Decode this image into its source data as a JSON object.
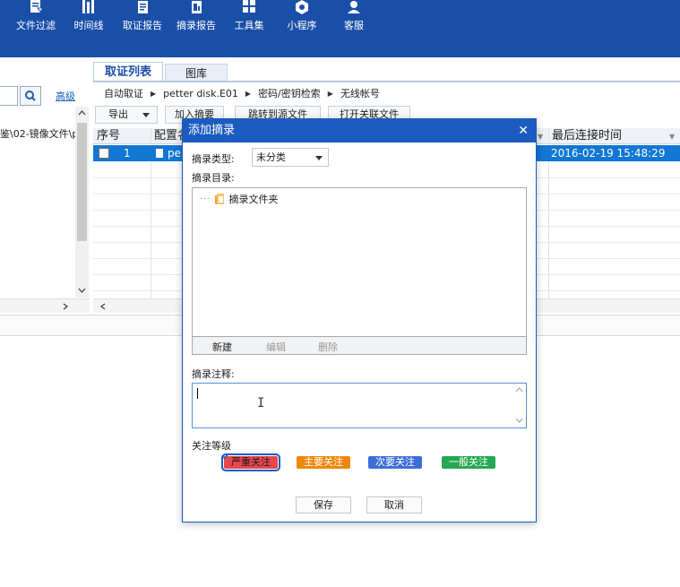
{
  "toolbar": {
    "items": [
      {
        "label": "文件过滤",
        "icon": "file-filter-icon"
      },
      {
        "label": "时间线",
        "icon": "timeline-icon"
      },
      {
        "label": "取证报告",
        "icon": "forensic-report-icon"
      },
      {
        "label": "摘录报告",
        "icon": "excerpt-report-icon"
      },
      {
        "label": "工具集",
        "icon": "toolset-icon"
      },
      {
        "label": "小程序",
        "icon": "mini-program-icon"
      },
      {
        "label": "客服",
        "icon": "customer-service-icon"
      }
    ]
  },
  "left_panel": {
    "advanced_label": "高级",
    "tree_text": "鉴\\02-镜像文件\\p"
  },
  "tabs": [
    {
      "label": "取证列表",
      "active": true
    },
    {
      "label": "图库",
      "active": false
    }
  ],
  "breadcrumb": [
    "自动取证",
    "petter disk.E01",
    "密码/密钥检索",
    "无线帐号"
  ],
  "list_toolbar": {
    "export_label": "导出",
    "add_excerpt_label": "加入摘要",
    "jump_source_label": "跳转到源文件",
    "open_related_label": "打开关联文件"
  },
  "grid": {
    "columns": [
      "序号",
      "配置名",
      "最后连接时间"
    ],
    "rows": [
      {
        "index": "1",
        "name": "pe",
        "last_connected": "2016-02-19 15:48:29"
      }
    ]
  },
  "dialog": {
    "title": "添加摘录",
    "type_label": "摘录类型:",
    "type_value": "未分类",
    "dir_label": "摘录目录:",
    "tree_root": "摘录文件夹",
    "new_label": "新建",
    "edit_label": "编辑",
    "delete_label": "删除",
    "note_label": "摘录注释:",
    "level_label": "关注等级",
    "levels": [
      {
        "label": "严重关注",
        "color": "#e8474e",
        "selected": true
      },
      {
        "label": "主要关注",
        "color": "#f0870e",
        "selected": false
      },
      {
        "label": "次要关注",
        "color": "#3e6fd6",
        "selected": false
      },
      {
        "label": "一般关注",
        "color": "#26a851",
        "selected": false
      }
    ],
    "save_label": "保存",
    "cancel_label": "取消"
  },
  "colors": {
    "brand": "#1a4fa8",
    "selection": "#1177d4",
    "dialog_title": "#1c5cc1"
  }
}
